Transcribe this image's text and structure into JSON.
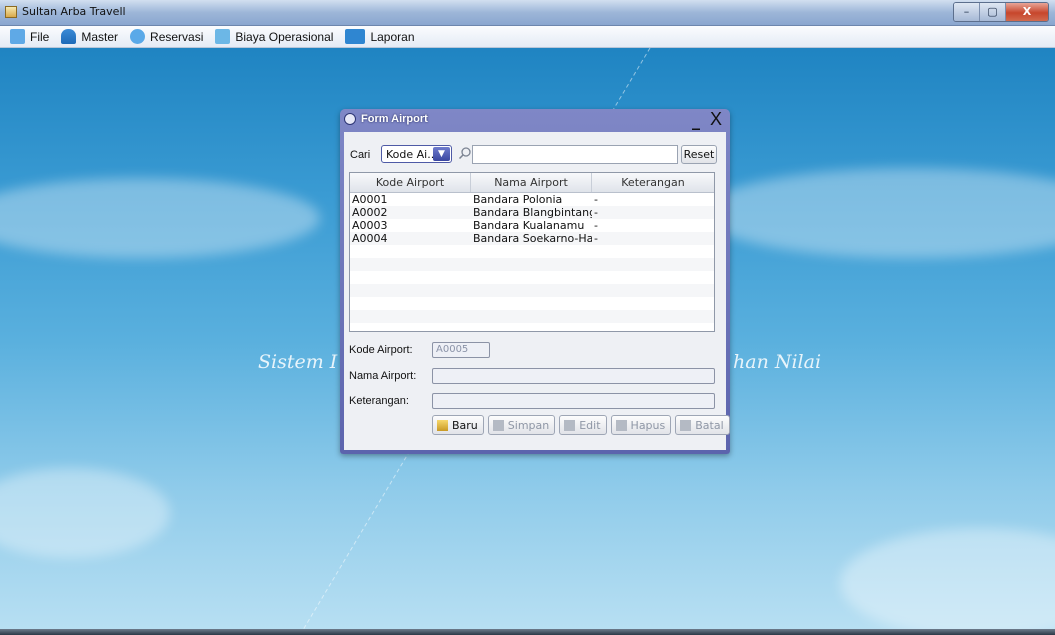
{
  "window": {
    "title": "Sultan Arba Travell",
    "controls": [
      "–",
      "▢",
      "X"
    ]
  },
  "menu": [
    {
      "label": "File",
      "icon": "file-icon",
      "color": "#5fa9e6"
    },
    {
      "label": "Master",
      "icon": "users-icon",
      "color": "#3b8ad6"
    },
    {
      "label": "Reservasi",
      "icon": "reservation-icon",
      "color": "#5aa9e8"
    },
    {
      "label": "Biaya Operasional",
      "icon": "document-icon",
      "color": "#6cb7e6"
    },
    {
      "label": "Laporan",
      "icon": "report-icon",
      "color": "#2f86d1"
    }
  ],
  "watermark": {
    "left": "Sistem I",
    "right": "han Nilai"
  },
  "dialog": {
    "title": "Form Airport",
    "minimize": "_",
    "close": "X",
    "search": {
      "label": "Cari",
      "combo_value": "Kode Ai...",
      "input_value": "",
      "reset_label": "Reset"
    },
    "table": {
      "headers": [
        "Kode Airport",
        "Nama Airport",
        "Keterangan"
      ],
      "rows": [
        [
          "A0001",
          "Bandara Polonia",
          "-"
        ],
        [
          "A0002",
          "Bandara Blangbintang",
          "-"
        ],
        [
          "A0003",
          "Bandara Kualanamu",
          "-"
        ],
        [
          "A0004",
          "Bandara Soekarno-Hatta",
          "-"
        ]
      ]
    },
    "form": {
      "kode_label": "Kode Airport:",
      "kode_value": "A0005",
      "nama_label": "Nama Airport:",
      "nama_value": "",
      "ket_label": "Keterangan:",
      "ket_value": ""
    },
    "buttons": {
      "baru": "Baru",
      "simpan": "Simpan",
      "edit": "Edit",
      "hapus": "Hapus",
      "batal": "Batal"
    }
  },
  "colors": {
    "desktop_top": "#1f84c2",
    "dialog_frame": "#6f78bd",
    "combo_accent": "#4e5aa6"
  }
}
